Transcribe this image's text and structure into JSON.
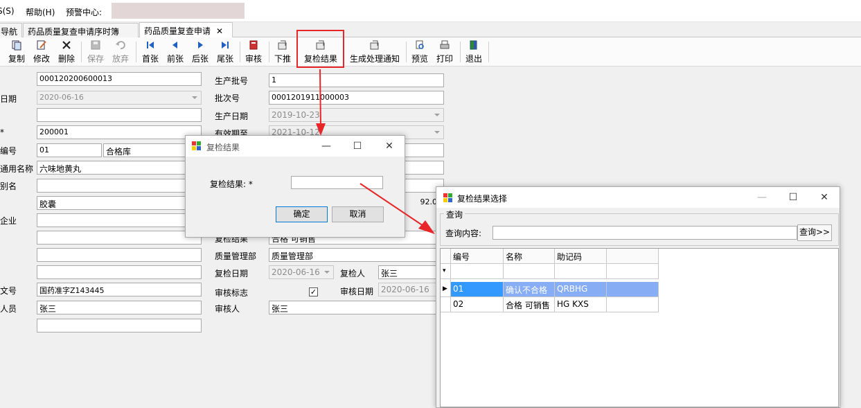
{
  "menu": {
    "item1": "S(S)",
    "item2": "帮助(H)",
    "item3": "预警中心:"
  },
  "tabs": {
    "tab1": "导航",
    "tab2": "药品质量复查申请序时簿",
    "tab3": "药品质量复查申请"
  },
  "toolbar": {
    "copy": "复制",
    "edit": "修改",
    "delete": "删除",
    "save": "保存",
    "discard": "放弃",
    "first": "首张",
    "prev": "前张",
    "next": "后张",
    "last": "尾张",
    "audit": "审核",
    "push": "下推",
    "recheck_result": "复检结果",
    "gen_notice": "生成处理通知",
    "preview": "预览",
    "print": "打印",
    "exit": "退出"
  },
  "form": {
    "label_date": "日期",
    "label_star": "*",
    "label_code": "编号",
    "label_common_name": "通用名称",
    "label_alias": "别名",
    "label_enterprise": "企业",
    "label_approval": "文号",
    "label_person": "人员",
    "doc_no": "000120200600013",
    "date": "2020-06-16",
    "customer": "200001",
    "warehouse_code": "01",
    "warehouse_name": "合格库",
    "common_name": "六味地黄丸",
    "dosage_form": "胶囊",
    "approval_no": "国药准字Z143445",
    "person": "张三",
    "label_prod_batch": "生产批号",
    "prod_batch": "1",
    "label_batch_no": "批次号",
    "batch_no": "0001201911000003",
    "label_prod_date": "生产日期",
    "prod_date": "2019-10-23",
    "label_expiry": "有效期至",
    "expiry": "2021-10-12",
    "qty_partial": "92.00",
    "label_recheck_result": "复检结果",
    "recheck_result_value": "合格 可销售",
    "label_qa_dept": "质量管理部",
    "qa_dept": "质量管理部",
    "label_recheck_date": "复检日期",
    "recheck_date": "2020-06-16",
    "label_recheck_person": "复检人",
    "recheck_person": "张三",
    "label_audit_flag": "审核标志",
    "audit_flag_checked": "✓",
    "label_audit_date": "审核日期",
    "audit_date": "2020-06-16",
    "label_auditor": "审核人",
    "auditor": "张三"
  },
  "dialog1": {
    "title": "复检结果",
    "field_label": "复检结果: *",
    "field_value": "",
    "ok": "确定",
    "cancel": "取消"
  },
  "dialog2": {
    "title": "复检结果选择",
    "group_label": "查询",
    "query_label": "查询内容:",
    "query_value": "",
    "query_button": "查询>>",
    "columns": [
      "编号",
      "名称",
      "助记码"
    ],
    "rows": [
      {
        "code": "01",
        "name": "确认不合格",
        "mnemonic": "QRBHG"
      },
      {
        "code": "02",
        "name": "合格 可销售",
        "mnemonic": "HG KXS"
      }
    ]
  },
  "colors": {
    "annotation_red": "#e8262a",
    "selection_blue": "#87aef5"
  }
}
